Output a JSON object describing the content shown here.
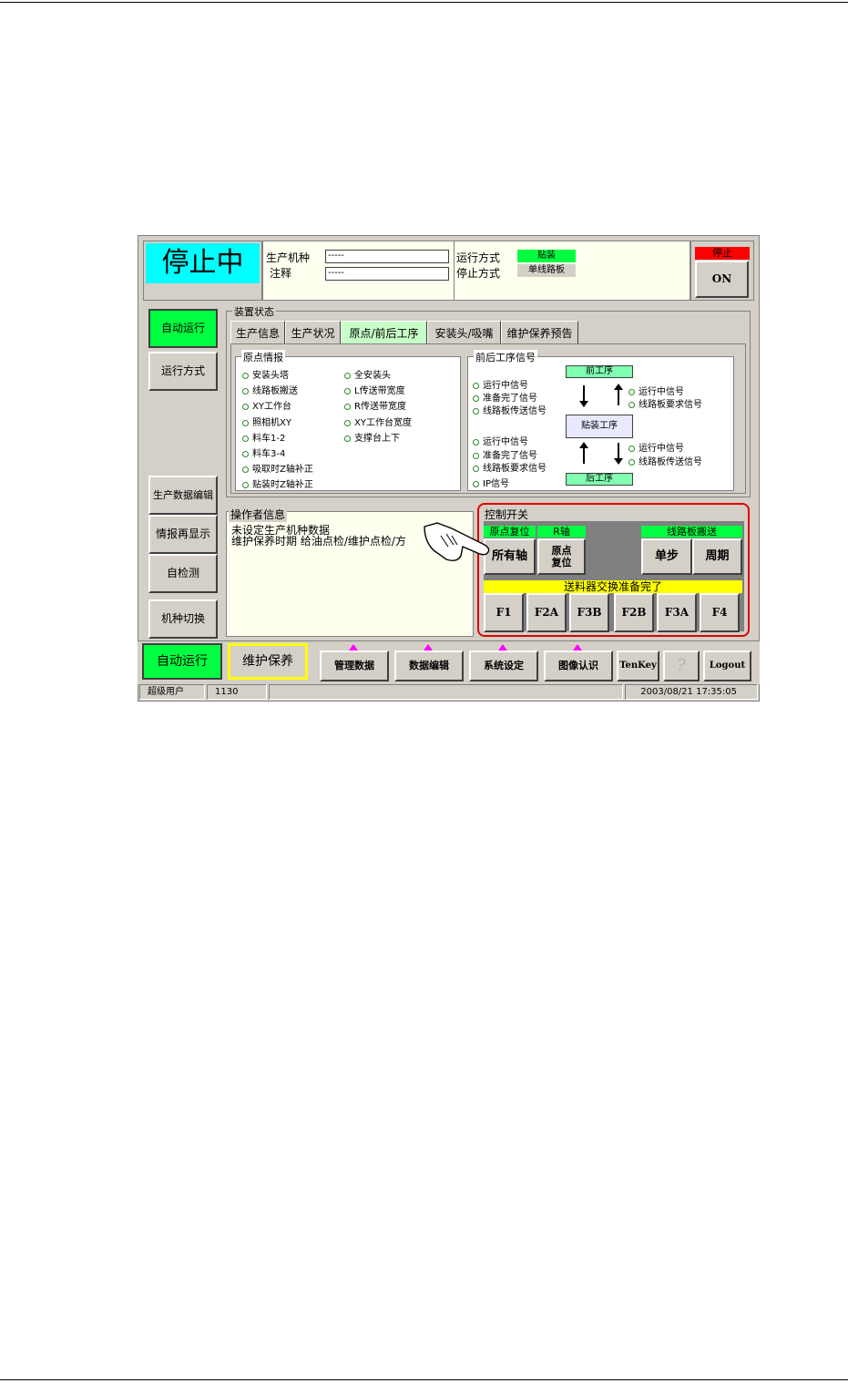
{
  "status": {
    "state_text": "停止中"
  },
  "header": {
    "model_label": "生产机种",
    "model_value": "-----",
    "note_label": "注释",
    "note_value": "-----",
    "run_mode_label": "运行方式",
    "run_mode_value": "贴装",
    "stop_mode_label": "停止方式",
    "stop_mode_value": "单线路板",
    "stop_header": "停止",
    "on_label": "ON"
  },
  "sidebar": {
    "auto_run": "自动运行",
    "run_mode": "运行方式",
    "prod_edit": "生产数据编辑",
    "info_redisplay": "情报再显示",
    "self_check": "自检测",
    "model_switch": "机种切换"
  },
  "device_status": {
    "title": "装置状态",
    "tabs": [
      "生产信息",
      "生产状况",
      "原点/前后工序",
      "安装头/吸嘴",
      "维护保养预告"
    ],
    "origin_info": {
      "title": "原点情报",
      "left": [
        "安装头塔",
        "线路板搬送",
        "XY工作台",
        "照相机XY",
        "料车1-2",
        "料车3-4",
        "吸取时Z轴补正",
        "贴装时Z轴补正"
      ],
      "right": [
        "全安装头",
        "L传送带宽度",
        "R传送带宽度",
        "XY工作台宽度",
        "支撑台上下"
      ]
    },
    "process_signals": {
      "title": "前后工序信号",
      "upper_left": [
        "运行中信号",
        "准备完了信号",
        "线路板传送信号"
      ],
      "upper_right": [
        "运行中信号",
        "线路板要求信号"
      ],
      "lower_left": [
        "运行中信号",
        "准备完了信号",
        "线路板要求信号",
        "IP信号"
      ],
      "lower_right": [
        "运行中信号",
        "线路板传送信号"
      ],
      "prev_process": "前工序",
      "mount_process": "贴装工序",
      "next_process": "后工序"
    }
  },
  "operator": {
    "title": "操作者信息",
    "line1": "未设定生产机种数据",
    "line2": "维护保养时期 给油点检/维护点检/方"
  },
  "control": {
    "title": "控制开关",
    "origin_reset": "原点复位",
    "r_axis": "R轴",
    "all_axes": "所有轴",
    "origin_reset_btn": "原点\n复位",
    "board_transfer": "线路板搬送",
    "step": "单步",
    "cycle": "周期",
    "feeder_ready": "送料器交换准备完了",
    "f_keys": [
      "F1",
      "F2A",
      "F3B",
      "F2B",
      "F3A",
      "F4"
    ]
  },
  "bottom": {
    "auto_run": "自动运行",
    "maintenance": "维护保养",
    "manage_data": "管理数据",
    "data_edit": "数据编辑",
    "system_setting": "系统设定",
    "image_recog": "图像认识",
    "tenkey": "TenKey",
    "help": "?",
    "logout": "Logout"
  },
  "statusbar": {
    "user": "超级用户",
    "code": "1130",
    "datetime": "2003/08/21 17:35:05"
  },
  "colors": {
    "cyan": "#00ffff",
    "green": "#00ff40",
    "red": "#ff0000",
    "yellow": "#ffff00",
    "panel": "#d4d0c8",
    "cream": "#fffff0"
  }
}
